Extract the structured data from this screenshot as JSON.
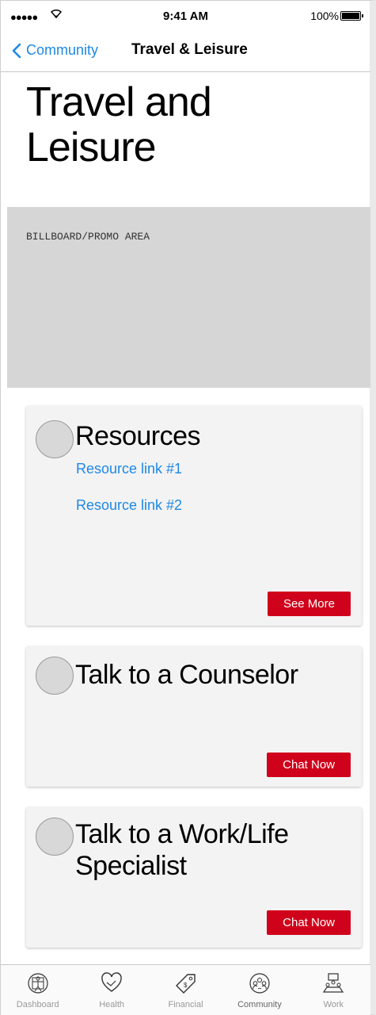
{
  "status_bar": {
    "signal": "●●●●●",
    "time": "9:41 AM",
    "battery": "100%"
  },
  "nav": {
    "back_label": "Community",
    "title": "Travel & Leisure"
  },
  "page": {
    "title_line1": "Travel and",
    "title_line2": "Leisure"
  },
  "billboard": {
    "text": "BILLBOARD/PROMO AREA"
  },
  "cards": [
    {
      "title": "Resources",
      "links": [
        "Resource link #1",
        "Resource link #2"
      ],
      "button": "See More"
    },
    {
      "title": "Talk to a Counselor",
      "button": "Chat Now"
    },
    {
      "title_line1": "Talk to a Work/Life",
      "title_line2": "Specialist",
      "button": "Chat Now"
    }
  ],
  "tabbar": {
    "items": [
      {
        "label": "Dashboard",
        "icon": "vitruvian-icon"
      },
      {
        "label": "Health",
        "icon": "heart-handshake-icon"
      },
      {
        "label": "Financial",
        "icon": "price-tag-icon"
      },
      {
        "label": "Community",
        "icon": "people-circle-icon"
      },
      {
        "label": "Work",
        "icon": "meeting-table-icon"
      }
    ]
  },
  "colors": {
    "accent": "#1e88e5",
    "button": "#d0021b",
    "billboard": "#d6d6d6",
    "card": "#f3f3f3"
  }
}
